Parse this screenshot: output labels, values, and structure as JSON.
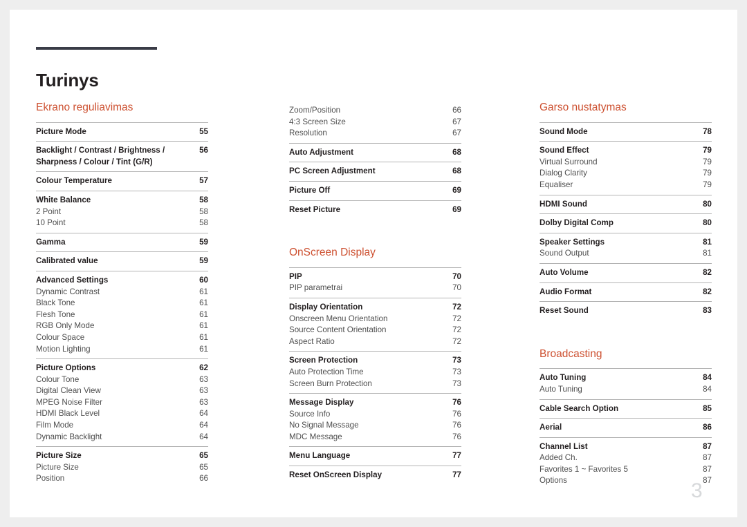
{
  "document": {
    "title": "Turinys",
    "page_number": "3",
    "accent_color": "#cd5030",
    "rule_color": "#3a3c47",
    "separator_color": "#b3b3b3"
  },
  "columns": [
    {
      "id": "column-1",
      "sections": [
        {
          "heading": "Ekrano reguliavimas",
          "groups": [
            {
              "entries": [
                {
                  "label": "Picture Mode",
                  "page": "55",
                  "level": "main"
                }
              ]
            },
            {
              "entries": [
                {
                  "label": "Backlight / Contrast / Brightness / Sharpness / Colour / Tint (G/R)",
                  "page": "56",
                  "level": "main",
                  "wrap": true
                }
              ]
            },
            {
              "entries": [
                {
                  "label": "Colour Temperature",
                  "page": "57",
                  "level": "main"
                }
              ]
            },
            {
              "entries": [
                {
                  "label": "White Balance",
                  "page": "58",
                  "level": "main"
                },
                {
                  "label": "2 Point",
                  "page": "58",
                  "level": "sub"
                },
                {
                  "label": "10 Point",
                  "page": "58",
                  "level": "sub"
                }
              ]
            },
            {
              "entries": [
                {
                  "label": "Gamma",
                  "page": "59",
                  "level": "main"
                }
              ]
            },
            {
              "entries": [
                {
                  "label": "Calibrated value",
                  "page": "59",
                  "level": "main"
                }
              ]
            },
            {
              "entries": [
                {
                  "label": "Advanced Settings",
                  "page": "60",
                  "level": "main"
                },
                {
                  "label": "Dynamic Contrast",
                  "page": "61",
                  "level": "sub"
                },
                {
                  "label": "Black Tone",
                  "page": "61",
                  "level": "sub"
                },
                {
                  "label": "Flesh Tone",
                  "page": "61",
                  "level": "sub"
                },
                {
                  "label": "RGB Only Mode",
                  "page": "61",
                  "level": "sub"
                },
                {
                  "label": "Colour Space",
                  "page": "61",
                  "level": "sub"
                },
                {
                  "label": "Motion Lighting",
                  "page": "61",
                  "level": "sub"
                }
              ]
            },
            {
              "entries": [
                {
                  "label": "Picture Options",
                  "page": "62",
                  "level": "main"
                },
                {
                  "label": "Colour Tone",
                  "page": "63",
                  "level": "sub"
                },
                {
                  "label": "Digital Clean View",
                  "page": "63",
                  "level": "sub"
                },
                {
                  "label": "MPEG Noise Filter",
                  "page": "63",
                  "level": "sub"
                },
                {
                  "label": "HDMI Black Level",
                  "page": "64",
                  "level": "sub"
                },
                {
                  "label": "Film Mode",
                  "page": "64",
                  "level": "sub"
                },
                {
                  "label": "Dynamic Backlight",
                  "page": "64",
                  "level": "sub"
                }
              ]
            },
            {
              "entries": [
                {
                  "label": "Picture Size",
                  "page": "65",
                  "level": "main"
                },
                {
                  "label": "Picture Size",
                  "page": "65",
                  "level": "sub"
                },
                {
                  "label": "Position",
                  "page": "66",
                  "level": "sub"
                }
              ]
            }
          ]
        }
      ]
    },
    {
      "id": "column-2",
      "sections": [
        {
          "heading": "",
          "groups": [
            {
              "no_rule": true,
              "entries": [
                {
                  "label": "Zoom/Position",
                  "page": "66",
                  "level": "sub"
                },
                {
                  "label": "4:3 Screen Size",
                  "page": "67",
                  "level": "sub"
                },
                {
                  "label": "Resolution",
                  "page": "67",
                  "level": "sub"
                }
              ]
            },
            {
              "entries": [
                {
                  "label": "Auto Adjustment",
                  "page": "68",
                  "level": "main"
                }
              ]
            },
            {
              "entries": [
                {
                  "label": "PC Screen Adjustment",
                  "page": "68",
                  "level": "main"
                }
              ]
            },
            {
              "entries": [
                {
                  "label": "Picture Off",
                  "page": "69",
                  "level": "main"
                }
              ]
            },
            {
              "entries": [
                {
                  "label": "Reset Picture",
                  "page": "69",
                  "level": "main"
                }
              ]
            }
          ]
        },
        {
          "heading": "OnScreen Display",
          "spacer": true,
          "groups": [
            {
              "entries": [
                {
                  "label": "PIP",
                  "page": "70",
                  "level": "main"
                },
                {
                  "label": "PIP parametrai",
                  "page": "70",
                  "level": "sub"
                }
              ]
            },
            {
              "entries": [
                {
                  "label": "Display Orientation",
                  "page": "72",
                  "level": "main"
                },
                {
                  "label": "Onscreen Menu Orientation",
                  "page": "72",
                  "level": "sub"
                },
                {
                  "label": "Source Content Orientation",
                  "page": "72",
                  "level": "sub"
                },
                {
                  "label": "Aspect Ratio",
                  "page": "72",
                  "level": "sub"
                }
              ]
            },
            {
              "entries": [
                {
                  "label": "Screen Protection",
                  "page": "73",
                  "level": "main"
                },
                {
                  "label": "Auto Protection Time",
                  "page": "73",
                  "level": "sub"
                },
                {
                  "label": "Screen Burn Protection",
                  "page": "73",
                  "level": "sub"
                }
              ]
            },
            {
              "entries": [
                {
                  "label": "Message Display",
                  "page": "76",
                  "level": "main"
                },
                {
                  "label": "Source Info",
                  "page": "76",
                  "level": "sub"
                },
                {
                  "label": "No Signal Message",
                  "page": "76",
                  "level": "sub"
                },
                {
                  "label": "MDC Message",
                  "page": "76",
                  "level": "sub"
                }
              ]
            },
            {
              "entries": [
                {
                  "label": "Menu Language",
                  "page": "77",
                  "level": "main"
                }
              ]
            },
            {
              "entries": [
                {
                  "label": "Reset OnScreen Display",
                  "page": "77",
                  "level": "main"
                }
              ]
            }
          ]
        }
      ]
    },
    {
      "id": "column-3",
      "sections": [
        {
          "heading": "Garso nustatymas",
          "groups": [
            {
              "entries": [
                {
                  "label": "Sound Mode",
                  "page": "78",
                  "level": "main"
                }
              ]
            },
            {
              "entries": [
                {
                  "label": "Sound Effect",
                  "page": "79",
                  "level": "main"
                },
                {
                  "label": "Virtual Surround",
                  "page": "79",
                  "level": "sub"
                },
                {
                  "label": "Dialog Clarity",
                  "page": "79",
                  "level": "sub"
                },
                {
                  "label": "Equaliser",
                  "page": "79",
                  "level": "sub"
                }
              ]
            },
            {
              "entries": [
                {
                  "label": "HDMI Sound",
                  "page": "80",
                  "level": "main"
                }
              ]
            },
            {
              "entries": [
                {
                  "label": "Dolby Digital Comp",
                  "page": "80",
                  "level": "main"
                }
              ]
            },
            {
              "entries": [
                {
                  "label": "Speaker Settings",
                  "page": "81",
                  "level": "main"
                },
                {
                  "label": "Sound Output",
                  "page": "81",
                  "level": "sub"
                }
              ]
            },
            {
              "entries": [
                {
                  "label": "Auto Volume",
                  "page": "82",
                  "level": "main"
                }
              ]
            },
            {
              "entries": [
                {
                  "label": "Audio Format",
                  "page": "82",
                  "level": "main"
                }
              ]
            },
            {
              "entries": [
                {
                  "label": "Reset Sound",
                  "page": "83",
                  "level": "main"
                }
              ]
            }
          ]
        },
        {
          "heading": "Broadcasting",
          "spacer": true,
          "groups": [
            {
              "entries": [
                {
                  "label": "Auto Tuning",
                  "page": "84",
                  "level": "main"
                },
                {
                  "label": "Auto Tuning",
                  "page": "84",
                  "level": "sub"
                }
              ]
            },
            {
              "entries": [
                {
                  "label": "Cable Search Option",
                  "page": "85",
                  "level": "main"
                }
              ]
            },
            {
              "entries": [
                {
                  "label": "Aerial",
                  "page": "86",
                  "level": "main"
                }
              ]
            },
            {
              "entries": [
                {
                  "label": "Channel List",
                  "page": "87",
                  "level": "main"
                },
                {
                  "label": "Added Ch.",
                  "page": "87",
                  "level": "sub"
                },
                {
                  "label": "Favorites 1 ~ Favorites 5",
                  "page": "87",
                  "level": "sub"
                },
                {
                  "label": "Options",
                  "page": "87",
                  "level": "sub"
                }
              ]
            }
          ]
        }
      ]
    }
  ]
}
